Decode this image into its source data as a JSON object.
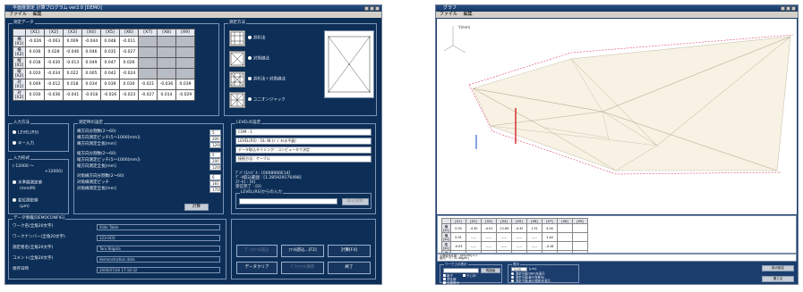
{
  "left_window": {
    "title": "平面度測定 計算プログラム ver2.0 [DEMO]",
    "menu": [
      "ファイル",
      "編集"
    ],
    "measure_group": "測定データ",
    "table": {
      "headers": [
        "",
        "[X1]",
        "[X2]",
        "[X3]",
        "[X4]",
        "[X5]",
        "[X6]",
        "[X7]",
        "[X8]",
        "[X9]"
      ],
      "rows": [
        {
          "label": "横[X1]",
          "values": [
            "-0.026",
            "-0.003",
            "0.009",
            "-0.044",
            "0.048",
            "-0.011",
            "",
            "",
            ""
          ]
        },
        {
          "label": "横[X2]",
          "values": [
            "0.036",
            "0.028",
            "-0.046",
            "0.046",
            "0.035",
            "-0.027",
            "",
            "",
            ""
          ]
        },
        {
          "label": "縦[X1]",
          "values": [
            "0.018",
            "-0.030",
            "-0.013",
            "0.049",
            "0.047",
            "0.026",
            "",
            "",
            ""
          ]
        },
        {
          "label": "縦[X2]",
          "values": [
            "0.020",
            "-0.034",
            "0.022",
            "0.005",
            "0.042",
            "-0.024",
            "",
            "",
            ""
          ]
        },
        {
          "label": "対[X1]",
          "values": [
            "0.049",
            "-0.012",
            "0.018",
            "0.034",
            "0.039",
            "0.030",
            "-0.021",
            "-0.036",
            "0.039"
          ]
        },
        {
          "label": "対[X2]",
          "values": [
            "0.030",
            "-0.036",
            "-0.041",
            "-0.018",
            "-0.026",
            "-0.023",
            "-0.027",
            "0.014",
            "-0.029"
          ]
        }
      ]
    },
    "method_group": "測定方法",
    "methods": [
      "井桁法",
      "対角線法",
      "井桁法＋対角線法",
      "ユニオンジャック"
    ],
    "input_group": "入力方法",
    "input_options": [
      "LEVEL(RS)",
      "キー入力"
    ],
    "format_group": "入力形式",
    "format_range_1": "(-12000 ～",
    "format_range_2": "+12000)",
    "format_options": [
      "水準器測定値",
      "(mm/M)",
      "変位測定値",
      "(μm)"
    ],
    "setting_group": "測定時の設定",
    "settings": [
      {
        "label": "横方向分割数(2～60)",
        "value": "5"
      },
      {
        "label": "横方向測定ピッチ(5～1000[mm])",
        "value": "200"
      },
      {
        "label": "横方向測定全長[mm]",
        "value": "1200"
      },
      {
        "label": "縦方向分割数(2～60)",
        "value": "5"
      },
      {
        "label": "縦方向測定ピッチ(5～1000[mm])",
        "value": "200"
      },
      {
        "label": "縦方向測定全長[mm]",
        "value": "1200"
      },
      {
        "label": "対角線方向分割数(2～60)",
        "value": "6"
      },
      {
        "label": "対角線測定ピッチ",
        "value": "183"
      },
      {
        "label": "対角線測定全長[mm]",
        "value": "1701"
      }
    ],
    "calc_button": "計算",
    "level_group": "LEVELの設定",
    "level_info": [
      "COM : 1",
      "LEVEL(RS) : OL-38 (ﾃﾞｼﾞﾀﾙ水平器)",
      "データ取込タイミング：コンピュータで決定",
      "接続方法：ケーブル"
    ],
    "device_lines": [
      "ﾃﾞﾊﾞｲｽﾊﾝﾄﾞﾙ : [0008900E14]",
      "ﾃﾞｰﾀ取込範囲 : [1.285929176498]",
      "ｽﾃｰﾀｽ : [0]",
      "受信完了 : [0]"
    ],
    "level_input_group": "LEVEL(RS)からの入力",
    "level_input_button": "取込開始",
    "info_group": "データ情報[DEMOCONFIG]",
    "info_fields": [
      {
        "label": "ワーク名(全角20文字)",
        "value": "Slide Table"
      },
      {
        "label": "ワークナンバー(全角20文字)",
        "value": "123-0CD"
      },
      {
        "label": "測定者名(全角20文字)",
        "value": "Taro Niigata"
      },
      {
        "label": "コメント(全角20文字)",
        "value": "demonstration data"
      },
      {
        "label": "保存日時",
        "value": "2000/07/26  17:18:32"
      }
    ],
    "buttons": [
      "ﾃﾞｰﾀﾌｧｲﾙ読込",
      "ﾌｧｲﾙ読込...[F2]",
      "計算[F4]",
      "データクリア",
      "ｸﾞﾗﾌﾌｧｲﾙ保存",
      "終了"
    ]
  },
  "right_window": {
    "title": "グラフ",
    "menu": [
      "ファイル",
      "編集"
    ],
    "axis_label": "Y(mm)",
    "mini_headers": [
      "",
      "[X1]",
      "[X2]",
      "[X3]",
      "[X4]",
      "[X5]",
      "[X6]",
      "[X7]",
      "[X8]",
      "[X9]"
    ],
    "mini_rows": [
      [
        "横[X1]",
        "0.00",
        "-4.30",
        "-4.01",
        "-11.69",
        "-4.32",
        "1.51",
        "4.04",
        "",
        ""
      ],
      [
        "横[X2]",
        "0.01",
        "-----",
        "-----",
        "-----",
        "-----",
        "-----",
        "1.44",
        "",
        ""
      ],
      [
        "縦[X1]",
        "-0.03",
        "-----",
        "-----",
        "-----",
        "-----",
        "-----",
        "-4.18",
        "",
        ""
      ],
      [
        "縦[X2]",
        "0~14.56",
        "-----",
        "-----",
        "-----",
        "-----",
        "-----",
        "-4.53",
        "",
        ""
      ],
      [
        "対[X1]",
        "-3.87",
        "-----",
        "-----",
        "-----",
        "-----",
        "-----",
        "-6.55",
        "",
        ""
      ],
      [
        "対[X2]",
        "-3.17",
        "-----",
        "-----",
        "-----",
        "-----",
        "-----",
        "0.61",
        "",
        ""
      ],
      [
        "横[X3]",
        "0.00",
        "5.12",
        "5.09",
        "-0.62",
        "-0.42",
        "2.17",
        "-4.18",
        "",
        ""
      ],
      [
        "縦[X3]",
        "0.00",
        "4.47",
        "-4.18",
        "9.13",
        "5.28",
        "5.38",
        "9.18",
        "-10.16",
        "-6.18"
      ],
      [
        "対[X3]",
        "0.00",
        "48.00",
        "6.93",
        "1.51",
        "1.21",
        "-0.67",
        "-8.45",
        "2.14",
        "0.00"
      ]
    ],
    "summary": [
      "平面度測定値 :  100[μm] 0.1",
      "平面度測定値 :  100[μm] 0.1",
      "最大ﾃﾞｰﾀ : 31.46[μm]"
    ],
    "ctrl_group_1": "ワーク上の表示",
    "ctrl_input": "",
    "ctrl_btn_1": "再描画",
    "ctrl_checks": [
      "格子",
      "やじ印",
      "測定線",
      "目盛表示"
    ],
    "ctrl_group_2": "表示",
    "ctrl_scale": "2.00",
    "ctrl_scale_unit": "[μm]",
    "ctrl_radios": [
      "測定平面(GRA)を表示",
      "測定平面(最小自乗法)",
      "測定平面(最小領域)を表示"
    ],
    "right_buttons": [
      "色の設定",
      "閉じる"
    ]
  },
  "colors": {
    "panel": "#0d2f57",
    "title": "#264f86",
    "graph_bg": "#ffffff"
  }
}
